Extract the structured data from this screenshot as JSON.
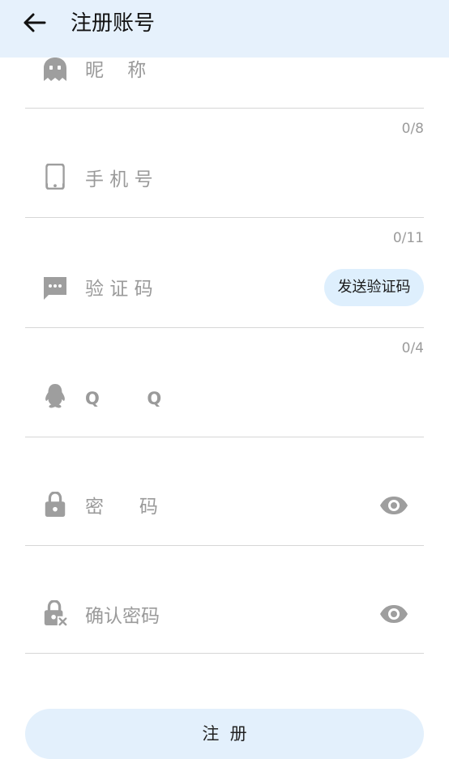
{
  "header": {
    "title": "注册账号",
    "back_icon": "arrow-left-icon"
  },
  "form": {
    "nickname": {
      "label": "昵    称",
      "counter": "0/8",
      "icon": "ghost-icon"
    },
    "phone": {
      "label": "手 机 号",
      "counter": "0/11",
      "icon": "phone-icon"
    },
    "code": {
      "label": "验 证 码",
      "counter": "0/4",
      "icon": "message-icon",
      "send_label": "发送验证码"
    },
    "qq": {
      "label": "Q        Q",
      "icon": "qq-penguin-icon"
    },
    "password": {
      "label": "密      码",
      "icon": "lock-icon"
    },
    "confirm": {
      "label": "确认密码",
      "icon": "lock-x-icon"
    }
  },
  "register_label": "注  册",
  "colors": {
    "header_bg": "#e6f1fc",
    "button_bg": "#e3f0fc",
    "icon": "#9e9e9e"
  }
}
